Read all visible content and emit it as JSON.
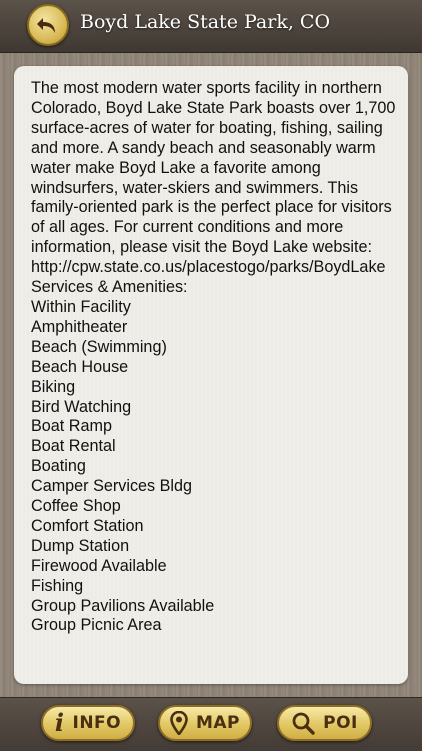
{
  "header": {
    "title": "Boyd Lake State Park, CO",
    "back_icon": "back-arrow-icon"
  },
  "content": {
    "description": "The most modern water sports facility in northern Colorado, Boyd Lake State Park boasts over 1,700 surface-acres of water for boating, fishing, sailing and more. A sandy beach and seasonably warm water make Boyd Lake a favorite among windsurfers, water-skiers and swimmers. This family-oriented park is the perfect place for visitors of all ages. For current conditions and more information, please visit the Boyd Lake website: http://cpw.state.co.us/placestogo/parks/BoydLake",
    "lines": [
      "Services & Amenities:",
      "Within Facility",
      "Amphitheater",
      "Beach (Swimming)",
      "Beach House",
      "Biking",
      "Bird Watching",
      "Boat Ramp",
      "Boat Rental",
      "Boating",
      "Camper Services Bldg",
      "Coffee Shop",
      "Comfort Station",
      "Dump Station",
      "Firewood Available",
      "Fishing",
      "Group Pavilions Available",
      "Group Picnic Area"
    ]
  },
  "tabbar": {
    "tabs": [
      {
        "label": "INFO",
        "icon": "info-icon"
      },
      {
        "label": "MAP",
        "icon": "map-pin-icon"
      },
      {
        "label": "POI",
        "icon": "search-icon"
      }
    ]
  },
  "colors": {
    "bar": "#4a423b",
    "button_gold": "#e2c864",
    "button_text": "#4a2f12"
  }
}
